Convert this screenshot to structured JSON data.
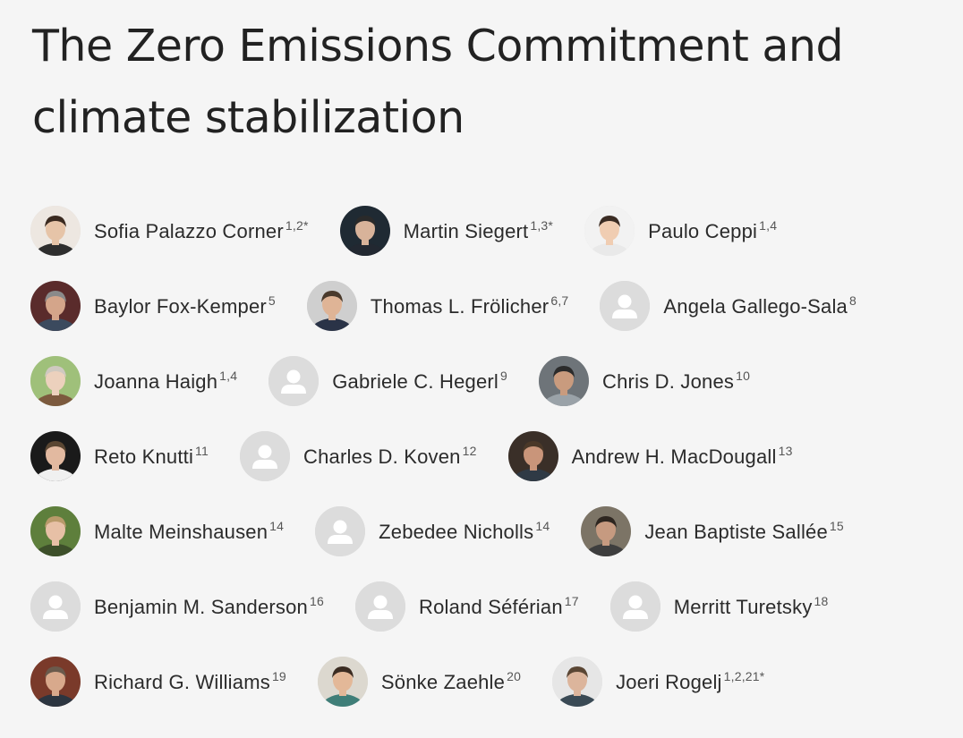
{
  "paper": {
    "title": "The Zero Emissions Commitment and climate stabilization"
  },
  "authors": [
    [
      {
        "name": "Sofia Palazzo Corner",
        "aff": "1,2*",
        "photo": true,
        "icon": "author-photo-icon",
        "skin": "#e6c4a8",
        "hair": "#3a2a20",
        "bg": "#ede7e1",
        "shirt": "#2e2e2e"
      },
      {
        "name": "Martin Siegert",
        "aff": "1,3*",
        "photo": true,
        "icon": "author-photo-icon",
        "skin": "#d8b39a",
        "hair": "#2a2a2a",
        "bg": "#1f2a33",
        "shirt": "#222831"
      },
      {
        "name": "Paulo Ceppi",
        "aff": "1,4",
        "photo": true,
        "icon": "author-photo-icon",
        "skin": "#f0cdb2",
        "hair": "#3b2c24",
        "bg": "#f2f2f2",
        "shirt": "#e9e9e9"
      }
    ],
    [
      {
        "name": "Baylor Fox-Kemper",
        "aff": "5",
        "photo": true,
        "icon": "author-photo-icon",
        "skin": "#d4a58a",
        "hair": "#8a8a8a",
        "bg": "#5a2b2b",
        "shirt": "#3b4a5e"
      },
      {
        "name": "Thomas L. Frölicher",
        "aff": "6,7",
        "photo": true,
        "icon": "author-photo-icon",
        "skin": "#dfb496",
        "hair": "#4a3a2c",
        "bg": "#cfcfcf",
        "shirt": "#2a3347"
      },
      {
        "name": "Angela Gallego-Sala",
        "aff": "8",
        "photo": false,
        "icon": "default-avatar-icon"
      }
    ],
    [
      {
        "name": "Joanna Haigh",
        "aff": "1,4",
        "photo": true,
        "icon": "author-photo-icon",
        "skin": "#ecd1bd",
        "hair": "#cfc9c0",
        "bg": "#9fc07a",
        "shirt": "#7c5a3e"
      },
      {
        "name": "Gabriele C. Hegerl",
        "aff": "9",
        "photo": false,
        "icon": "default-avatar-icon"
      },
      {
        "name": "Chris D. Jones",
        "aff": "10",
        "photo": true,
        "icon": "author-photo-icon",
        "skin": "#c99b7e",
        "hair": "#2b2b2b",
        "bg": "#6e7479",
        "shirt": "#9aa2a8"
      }
    ],
    [
      {
        "name": "Reto Knutti",
        "aff": "11",
        "photo": true,
        "icon": "author-photo-icon",
        "skin": "#e2b9a0",
        "hair": "#5a4632",
        "bg": "#1a1a1a",
        "shirt": "#f0f0f0"
      },
      {
        "name": "Charles D. Koven",
        "aff": "12",
        "photo": false,
        "icon": "default-avatar-icon"
      },
      {
        "name": "Andrew H. MacDougall",
        "aff": "13",
        "photo": true,
        "icon": "author-photo-icon",
        "skin": "#c9957a",
        "hair": "#4a3828",
        "bg": "#3a2f28",
        "shirt": "#2f3a45"
      }
    ],
    [
      {
        "name": "Malte Meinshausen",
        "aff": "14",
        "photo": true,
        "icon": "author-photo-icon",
        "skin": "#e7c0a6",
        "hair": "#b89a6a",
        "bg": "#5e7f3c",
        "shirt": "#3d4f2a"
      },
      {
        "name": "Zebedee Nicholls",
        "aff": "14",
        "photo": false,
        "icon": "default-avatar-icon"
      },
      {
        "name": "Jean Baptiste Sallée",
        "aff": "15",
        "photo": true,
        "icon": "author-photo-icon",
        "skin": "#c69a80",
        "hair": "#2e2620",
        "bg": "#7c7466",
        "shirt": "#3e3e3e"
      }
    ],
    [
      {
        "name": "Benjamin M. Sanderson",
        "aff": "16",
        "photo": false,
        "icon": "default-avatar-icon"
      },
      {
        "name": "Roland Séférian",
        "aff": "17",
        "photo": false,
        "icon": "default-avatar-icon"
      },
      {
        "name": "Merritt Turetsky",
        "aff": "18",
        "photo": false,
        "icon": "default-avatar-icon"
      }
    ],
    [
      {
        "name": "Richard G. Williams",
        "aff": "19",
        "photo": true,
        "icon": "author-photo-icon",
        "skin": "#d8a98c",
        "hair": "#6a5a4c",
        "bg": "#7a3a2a",
        "shirt": "#2c3540"
      },
      {
        "name": "Sönke Zaehle",
        "aff": "20",
        "photo": true,
        "icon": "author-photo-icon",
        "skin": "#e3b898",
        "hair": "#3b2c22",
        "bg": "#dcd8cf",
        "shirt": "#3f7e78"
      },
      {
        "name": "Joeri Rogelj",
        "aff": "1,2,21*",
        "photo": true,
        "icon": "author-photo-icon",
        "skin": "#dcb59c",
        "hair": "#5a4634",
        "bg": "#e6e6e6",
        "shirt": "#3a4a55"
      }
    ]
  ],
  "colors": {
    "background": "#f5f5f5",
    "text": "#222222",
    "placeholder_circle": "#dcdcdc",
    "placeholder_figure": "#ffffff"
  }
}
